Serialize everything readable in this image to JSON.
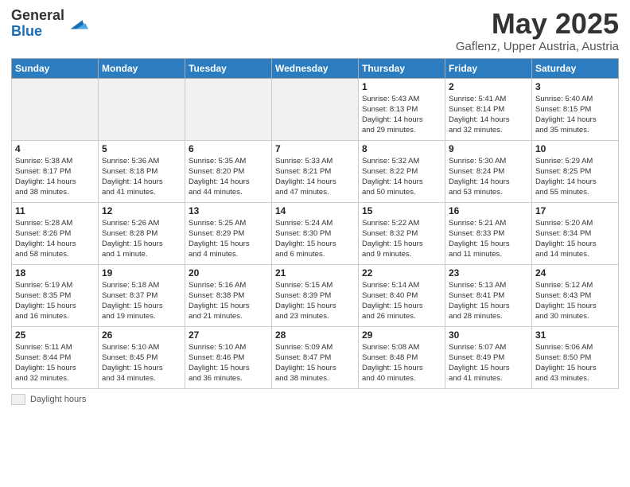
{
  "header": {
    "logo_general": "General",
    "logo_blue": "Blue",
    "title": "May 2025",
    "subtitle": "Gaflenz, Upper Austria, Austria"
  },
  "days_of_week": [
    "Sunday",
    "Monday",
    "Tuesday",
    "Wednesday",
    "Thursday",
    "Friday",
    "Saturday"
  ],
  "legend": {
    "label": "Daylight hours"
  },
  "weeks": [
    [
      {
        "day": "",
        "info": ""
      },
      {
        "day": "",
        "info": ""
      },
      {
        "day": "",
        "info": ""
      },
      {
        "day": "",
        "info": ""
      },
      {
        "day": "1",
        "info": "Sunrise: 5:43 AM\nSunset: 8:13 PM\nDaylight: 14 hours\nand 29 minutes."
      },
      {
        "day": "2",
        "info": "Sunrise: 5:41 AM\nSunset: 8:14 PM\nDaylight: 14 hours\nand 32 minutes."
      },
      {
        "day": "3",
        "info": "Sunrise: 5:40 AM\nSunset: 8:15 PM\nDaylight: 14 hours\nand 35 minutes."
      }
    ],
    [
      {
        "day": "4",
        "info": "Sunrise: 5:38 AM\nSunset: 8:17 PM\nDaylight: 14 hours\nand 38 minutes."
      },
      {
        "day": "5",
        "info": "Sunrise: 5:36 AM\nSunset: 8:18 PM\nDaylight: 14 hours\nand 41 minutes."
      },
      {
        "day": "6",
        "info": "Sunrise: 5:35 AM\nSunset: 8:20 PM\nDaylight: 14 hours\nand 44 minutes."
      },
      {
        "day": "7",
        "info": "Sunrise: 5:33 AM\nSunset: 8:21 PM\nDaylight: 14 hours\nand 47 minutes."
      },
      {
        "day": "8",
        "info": "Sunrise: 5:32 AM\nSunset: 8:22 PM\nDaylight: 14 hours\nand 50 minutes."
      },
      {
        "day": "9",
        "info": "Sunrise: 5:30 AM\nSunset: 8:24 PM\nDaylight: 14 hours\nand 53 minutes."
      },
      {
        "day": "10",
        "info": "Sunrise: 5:29 AM\nSunset: 8:25 PM\nDaylight: 14 hours\nand 55 minutes."
      }
    ],
    [
      {
        "day": "11",
        "info": "Sunrise: 5:28 AM\nSunset: 8:26 PM\nDaylight: 14 hours\nand 58 minutes."
      },
      {
        "day": "12",
        "info": "Sunrise: 5:26 AM\nSunset: 8:28 PM\nDaylight: 15 hours\nand 1 minute."
      },
      {
        "day": "13",
        "info": "Sunrise: 5:25 AM\nSunset: 8:29 PM\nDaylight: 15 hours\nand 4 minutes."
      },
      {
        "day": "14",
        "info": "Sunrise: 5:24 AM\nSunset: 8:30 PM\nDaylight: 15 hours\nand 6 minutes."
      },
      {
        "day": "15",
        "info": "Sunrise: 5:22 AM\nSunset: 8:32 PM\nDaylight: 15 hours\nand 9 minutes."
      },
      {
        "day": "16",
        "info": "Sunrise: 5:21 AM\nSunset: 8:33 PM\nDaylight: 15 hours\nand 11 minutes."
      },
      {
        "day": "17",
        "info": "Sunrise: 5:20 AM\nSunset: 8:34 PM\nDaylight: 15 hours\nand 14 minutes."
      }
    ],
    [
      {
        "day": "18",
        "info": "Sunrise: 5:19 AM\nSunset: 8:35 PM\nDaylight: 15 hours\nand 16 minutes."
      },
      {
        "day": "19",
        "info": "Sunrise: 5:18 AM\nSunset: 8:37 PM\nDaylight: 15 hours\nand 19 minutes."
      },
      {
        "day": "20",
        "info": "Sunrise: 5:16 AM\nSunset: 8:38 PM\nDaylight: 15 hours\nand 21 minutes."
      },
      {
        "day": "21",
        "info": "Sunrise: 5:15 AM\nSunset: 8:39 PM\nDaylight: 15 hours\nand 23 minutes."
      },
      {
        "day": "22",
        "info": "Sunrise: 5:14 AM\nSunset: 8:40 PM\nDaylight: 15 hours\nand 26 minutes."
      },
      {
        "day": "23",
        "info": "Sunrise: 5:13 AM\nSunset: 8:41 PM\nDaylight: 15 hours\nand 28 minutes."
      },
      {
        "day": "24",
        "info": "Sunrise: 5:12 AM\nSunset: 8:43 PM\nDaylight: 15 hours\nand 30 minutes."
      }
    ],
    [
      {
        "day": "25",
        "info": "Sunrise: 5:11 AM\nSunset: 8:44 PM\nDaylight: 15 hours\nand 32 minutes."
      },
      {
        "day": "26",
        "info": "Sunrise: 5:10 AM\nSunset: 8:45 PM\nDaylight: 15 hours\nand 34 minutes."
      },
      {
        "day": "27",
        "info": "Sunrise: 5:10 AM\nSunset: 8:46 PM\nDaylight: 15 hours\nand 36 minutes."
      },
      {
        "day": "28",
        "info": "Sunrise: 5:09 AM\nSunset: 8:47 PM\nDaylight: 15 hours\nand 38 minutes."
      },
      {
        "day": "29",
        "info": "Sunrise: 5:08 AM\nSunset: 8:48 PM\nDaylight: 15 hours\nand 40 minutes."
      },
      {
        "day": "30",
        "info": "Sunrise: 5:07 AM\nSunset: 8:49 PM\nDaylight: 15 hours\nand 41 minutes."
      },
      {
        "day": "31",
        "info": "Sunrise: 5:06 AM\nSunset: 8:50 PM\nDaylight: 15 hours\nand 43 minutes."
      }
    ]
  ]
}
